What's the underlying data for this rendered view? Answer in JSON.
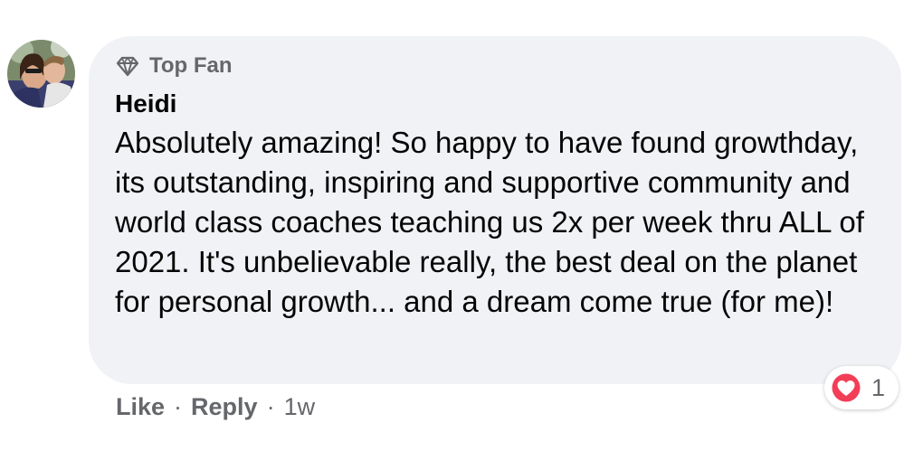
{
  "comment": {
    "badge": {
      "icon": "diamond-icon",
      "label": "Top Fan"
    },
    "author": "Heidi",
    "text": "Absolutely amazing! So happy to have found growthday, its outstanding, inspiring and supportive community and world class coaches teaching us 2x per week thru ALL of 2021. It's unbelievable really, the best deal on the planet for personal growth... and a dream come true (for me)!",
    "actions": {
      "like_label": "Like",
      "separator": "·",
      "reply_label": "Reply",
      "time": "1w"
    },
    "reactions": {
      "icon": "love-reaction-icon",
      "count": "1",
      "color": "#f33e58"
    }
  },
  "colors": {
    "bubble": "#f0f2f5",
    "text": "#050505",
    "secondary": "#65676b"
  }
}
